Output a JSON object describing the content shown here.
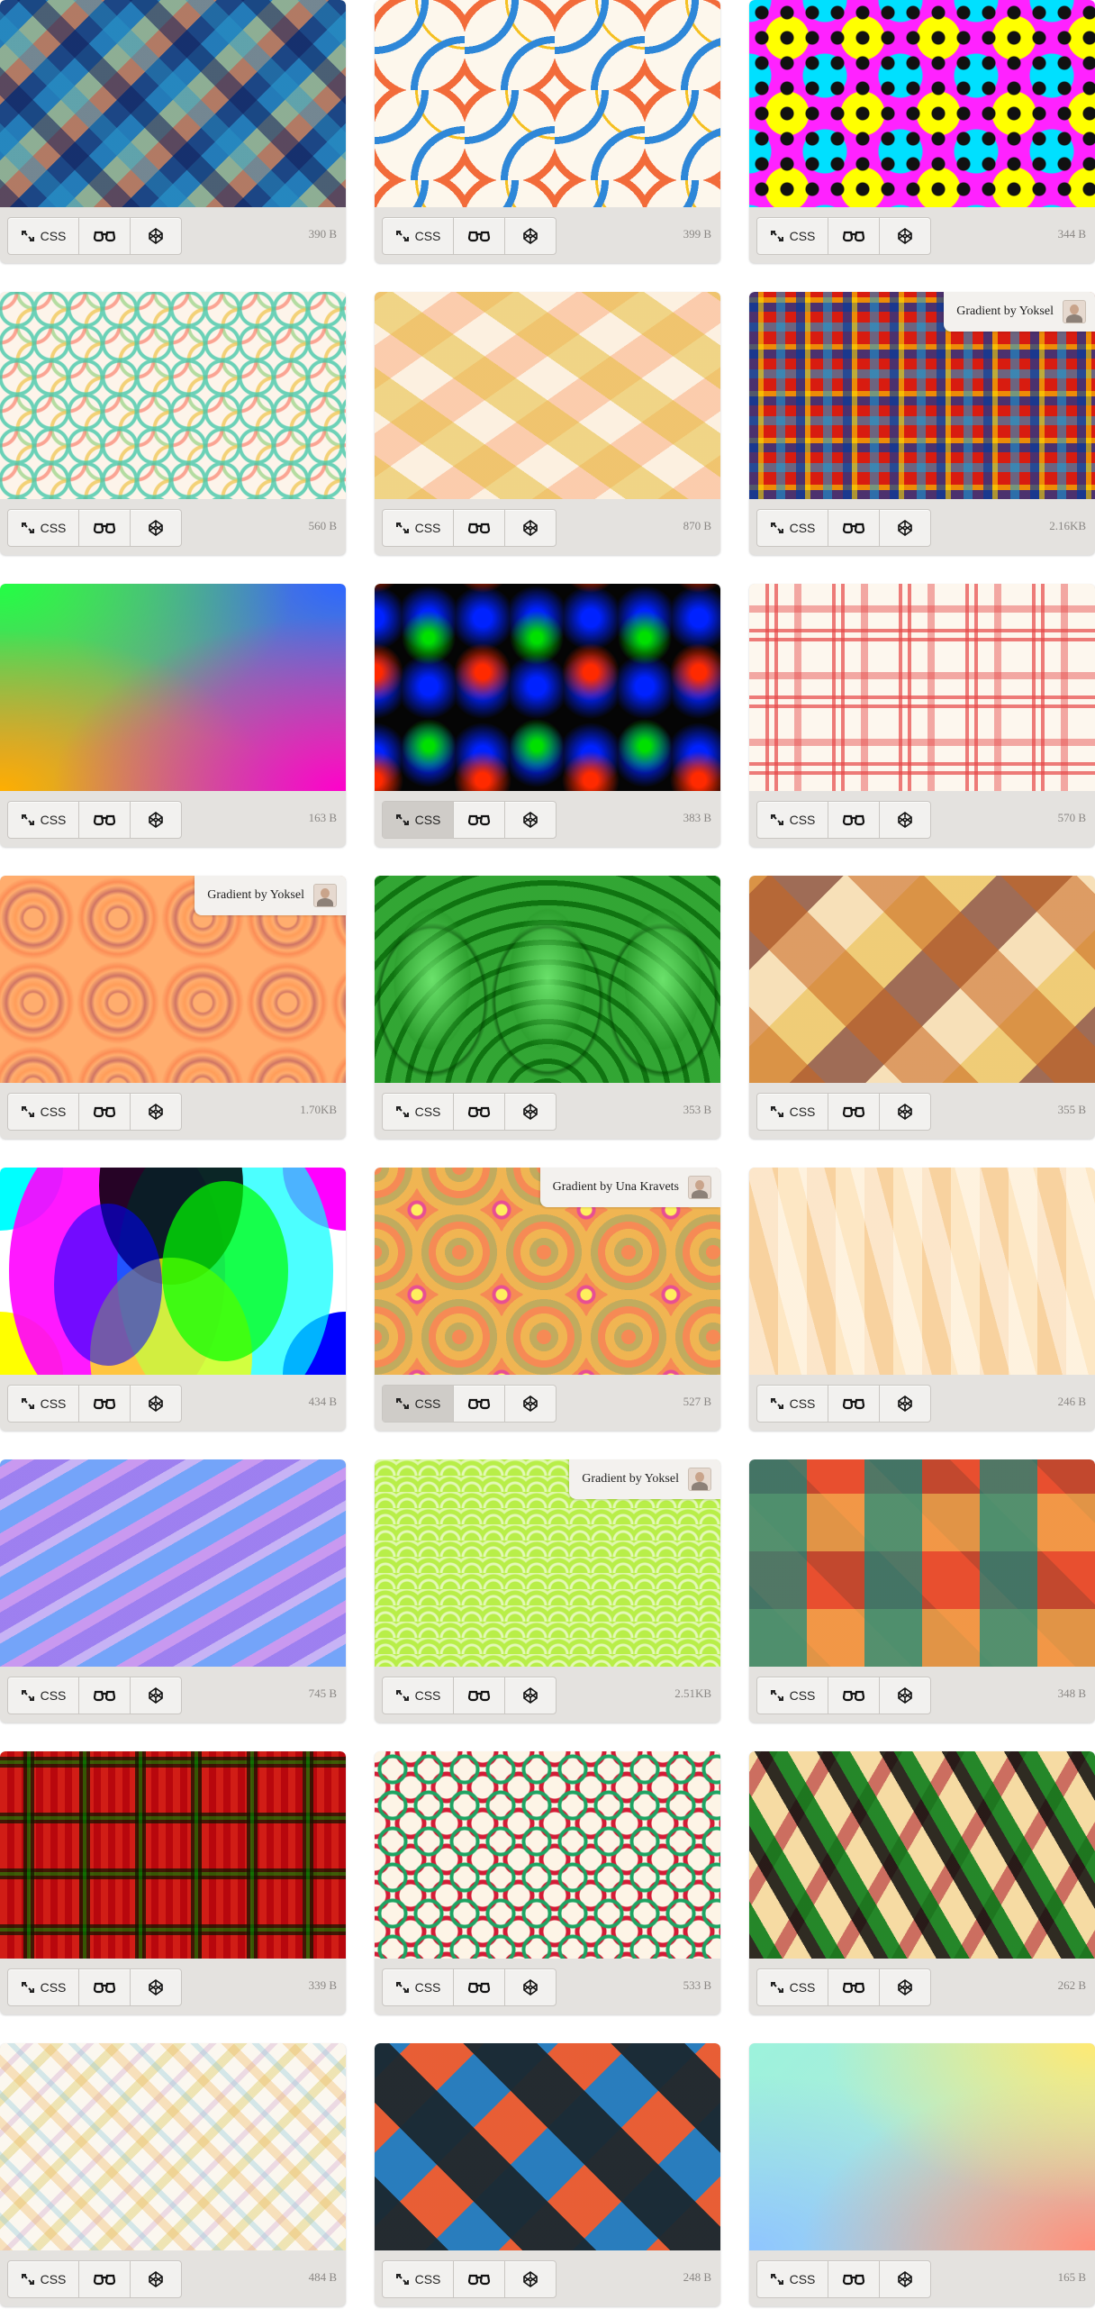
{
  "buttons": {
    "css_label": "CSS"
  },
  "icons": {
    "css": "code-transfer-icon",
    "view": "glasses-icon",
    "codepen": "codepen-icon",
    "avatar": "avatar-icon"
  },
  "cards": [
    {
      "size": "390 B"
    },
    {
      "size": "399 B"
    },
    {
      "size": "344 B"
    },
    {
      "size": "560 B"
    },
    {
      "size": "870 B"
    },
    {
      "size": "2.16KB",
      "credit": "Gradient by Yoksel"
    },
    {
      "size": "163 B"
    },
    {
      "size": "383 B",
      "active": "CSS"
    },
    {
      "size": "570 B"
    },
    {
      "size": "1.70KB",
      "credit": "Gradient by Yoksel"
    },
    {
      "size": "353 B"
    },
    {
      "size": "355 B"
    },
    {
      "size": "434 B"
    },
    {
      "size": "527 B",
      "credit": "Gradient by Una Kravets",
      "active": "CSS"
    },
    {
      "size": "246 B"
    },
    {
      "size": "745 B"
    },
    {
      "size": "2.51KB",
      "credit": "Gradient by Yoksel"
    },
    {
      "size": "348 B"
    },
    {
      "size": "339 B"
    },
    {
      "size": "533 B"
    },
    {
      "size": "262 B"
    },
    {
      "size": "484 B"
    },
    {
      "size": "248 B"
    },
    {
      "size": "165 B"
    }
  ]
}
